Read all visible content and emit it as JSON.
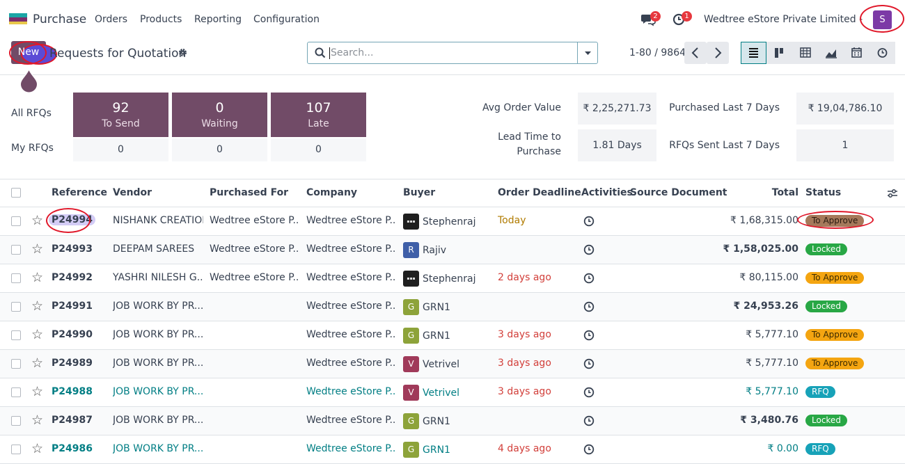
{
  "app": {
    "name": "Purchase",
    "menu": [
      "Orders",
      "Products",
      "Reporting",
      "Configuration"
    ],
    "messages_count": "2",
    "activities_count": "1",
    "company": "Wedtree eStore Private Limited - HO",
    "avatar_letter": "S"
  },
  "control": {
    "new_label": "New",
    "title": "Requests for Quotation",
    "search_placeholder": "Search...",
    "pager": "1-80 / 9864"
  },
  "dashboard": {
    "all_rfqs_label": "All RFQs",
    "my_rfqs_label": "My RFQs",
    "tiles": [
      {
        "value": "92",
        "label": "To Send"
      },
      {
        "value": "0",
        "label": "Waiting"
      },
      {
        "value": "107",
        "label": "Late"
      }
    ],
    "mine": [
      "0",
      "0",
      "0"
    ],
    "stats": {
      "avg_label": "Avg Order Value",
      "avg_value": "₹ 2,25,271.73",
      "lead_label_1": "Lead Time to",
      "lead_label_2": "Purchase",
      "lead_value": "1.81 Days",
      "purchased_label": "Purchased Last 7 Days",
      "purchased_value": "₹ 19,04,786.10",
      "sent_label": "RFQs Sent Last 7 Days",
      "sent_value": "1"
    }
  },
  "table": {
    "headers": {
      "reference": "Reference",
      "vendor": "Vendor",
      "purchased_for": "Purchased For",
      "company": "Company",
      "buyer": "Buyer",
      "deadline": "Order Deadline",
      "activities": "Activities",
      "source": "Source Document",
      "total": "Total",
      "status": "Status"
    },
    "rows": [
      {
        "ref": "P24994",
        "vendor": "NISHANK CREATION",
        "purchased_for": "Wedtree eStore P...",
        "company": "Wedtree eStore P...",
        "buyer": "Stephenraj",
        "buyer_initial": "",
        "deadline": "Today",
        "total": "₹ 1,68,315.00",
        "status": "To Approve"
      },
      {
        "ref": "P24993",
        "vendor": "DEEPAM SAREES",
        "purchased_for": "Wedtree eStore P...",
        "company": "Wedtree eStore P...",
        "buyer": "Rajiv",
        "buyer_initial": "R",
        "deadline": "",
        "total": "₹ 1,58,025.00",
        "status": "Locked"
      },
      {
        "ref": "P24992",
        "vendor": "YASHRI NILESH G...",
        "purchased_for": "Wedtree eStore P...",
        "company": "Wedtree eStore P...",
        "buyer": "Stephenraj",
        "buyer_initial": "",
        "deadline": "2 days ago",
        "total": "₹ 80,115.00",
        "status": "To Approve"
      },
      {
        "ref": "P24991",
        "vendor": "JOB WORK BY PR...",
        "purchased_for": "",
        "company": "Wedtree eStore P...",
        "buyer": "GRN1",
        "buyer_initial": "G",
        "deadline": "",
        "total": "₹ 24,953.26",
        "status": "Locked"
      },
      {
        "ref": "P24990",
        "vendor": "JOB WORK BY PR...",
        "purchased_for": "",
        "company": "Wedtree eStore P...",
        "buyer": "GRN1",
        "buyer_initial": "G",
        "deadline": "3 days ago",
        "total": "₹ 5,777.10",
        "status": "To Approve"
      },
      {
        "ref": "P24989",
        "vendor": "JOB WORK BY PR...",
        "purchased_for": "",
        "company": "Wedtree eStore P...",
        "buyer": "Vetrivel",
        "buyer_initial": "V",
        "deadline": "3 days ago",
        "total": "₹ 5,777.10",
        "status": "To Approve"
      },
      {
        "ref": "P24988",
        "vendor": "JOB WORK BY PR...",
        "purchased_for": "",
        "company": "Wedtree eStore P...",
        "buyer": "Vetrivel",
        "buyer_initial": "V",
        "deadline": "3 days ago",
        "total": "₹ 5,777.10",
        "status": "RFQ"
      },
      {
        "ref": "P24987",
        "vendor": "JOB WORK BY PR...",
        "purchased_for": "",
        "company": "Wedtree eStore P...",
        "buyer": "GRN1",
        "buyer_initial": "G",
        "deadline": "",
        "total": "₹ 3,480.76",
        "status": "Locked"
      },
      {
        "ref": "P24986",
        "vendor": "JOB WORK BY PR...",
        "purchased_for": "",
        "company": "Wedtree eStore P...",
        "buyer": "GRN1",
        "buyer_initial": "G",
        "deadline": "4 days ago",
        "total": "₹ 0.00",
        "status": "RFQ"
      }
    ]
  },
  "colors": {
    "brand": "#714b67",
    "teal": "#017e84",
    "danger": "#d23f3a",
    "warn_text": "#b07b00",
    "locked": "#28a745",
    "approve": "#f4a511",
    "rfq": "#17a2b8"
  }
}
